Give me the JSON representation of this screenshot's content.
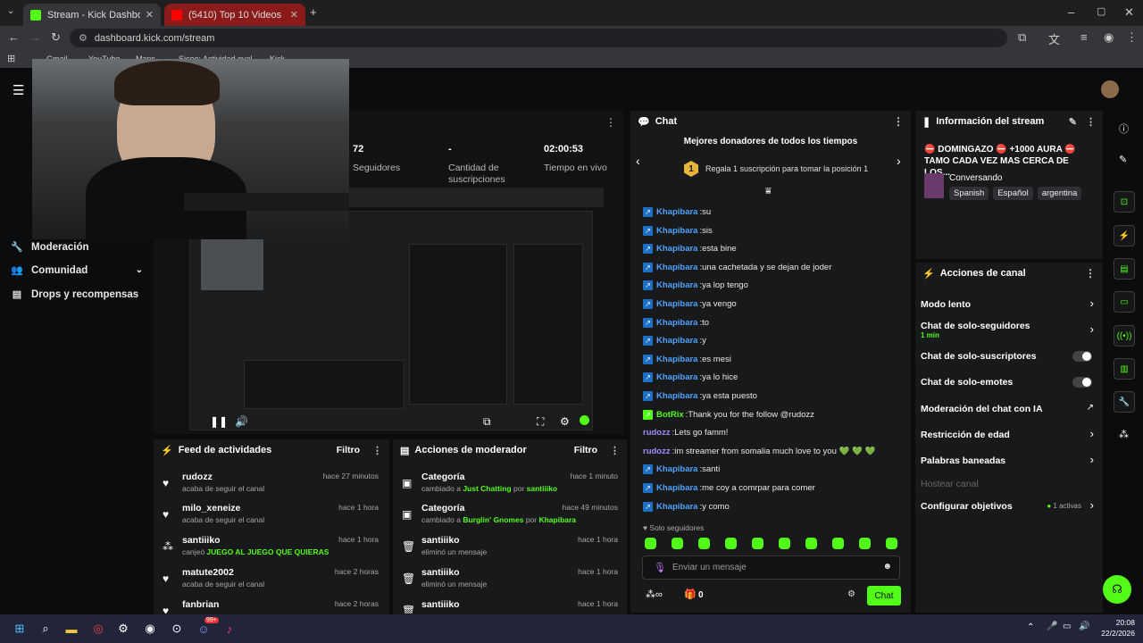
{
  "browser": {
    "tabs": [
      {
        "label": "Stream - Kick Dashboard",
        "active": true
      },
      {
        "label": "(5410) Top 10 Videos Escalofria",
        "active": false
      }
    ],
    "url": "dashboard.kick.com/stream",
    "bookmarks": [
      "Gmail",
      "YouTube",
      "Maps",
      "Sicee: Actividad eval",
      "Kick"
    ]
  },
  "sidebar": {
    "items": [
      {
        "label": "Moderación"
      },
      {
        "label": "Comunidad"
      },
      {
        "label": "Drops y recompensas"
      }
    ]
  },
  "stats": [
    {
      "value": "72",
      "label": "Seguidores"
    },
    {
      "value": "-",
      "label": "Cantidad de suscripciones"
    },
    {
      "value": "02:00:53",
      "label": "Tiempo en vivo"
    }
  ],
  "activity_feed": {
    "title": "Feed de actividades",
    "filter_label": "Filtro",
    "items": [
      {
        "name": "rudozz",
        "desc": "acaba de seguir el canal",
        "time": "hace 27 minutos",
        "icon": "heart-icon"
      },
      {
        "name": "milo_xeneize",
        "desc": "acaba de seguir el canal",
        "time": "hace 1 hora",
        "icon": "heart-icon"
      },
      {
        "name": "santiiiko",
        "desc_prefix": "canjeó ",
        "desc_highlight": "JUEGO AL JUEGO QUE QUIERAS",
        "time": "hace 1 hora",
        "icon": "reward-icon"
      },
      {
        "name": "matute2002",
        "desc": "acaba de seguir el canal",
        "time": "hace 2 horas",
        "icon": "heart-icon"
      },
      {
        "name": "fanbrian",
        "desc": "",
        "time": "hace 2 horas",
        "icon": "heart-icon"
      }
    ]
  },
  "mod_actions": {
    "title": "Acciones de moderador",
    "filter_label": "Filtro",
    "items": [
      {
        "name": "Categoría",
        "desc_prefix": "cambiado a ",
        "desc_highlight": "Just Chatting",
        "desc_mid": " por ",
        "desc_user": "santiiiko",
        "time": "hace 1 minuto"
      },
      {
        "name": "Categoría",
        "desc_prefix": "cambiado a ",
        "desc_highlight": "Burglin' Gnomes",
        "desc_mid": " por ",
        "desc_user": "Khapibara",
        "time": "hace 49 minutos"
      },
      {
        "name": "santiiiko",
        "desc_prefix": "eliminó un mensaje",
        "time": "hace 1 hora"
      },
      {
        "name": "santiiiko",
        "desc_prefix": "eliminó un mensaje",
        "time": "hace 1 hora"
      },
      {
        "name": "santiiiko",
        "desc_prefix": "",
        "time": "hace 1 hora"
      }
    ]
  },
  "chat": {
    "title": "Chat",
    "top_donors_title": "Mejores donadores de todos los tiempos",
    "donor_rank": "1",
    "donor_cta": "Regala 1 suscripción para tomar la posición 1",
    "messages": [
      {
        "user": "Khapibara",
        "text": "su",
        "type": "khapi"
      },
      {
        "user": "Khapibara",
        "text": "sis",
        "type": "khapi"
      },
      {
        "user": "Khapibara",
        "text": "esta bine",
        "type": "khapi"
      },
      {
        "user": "Khapibara",
        "text": "una cachetada y se dejan de joder",
        "type": "khapi"
      },
      {
        "user": "Khapibara",
        "text": "ya lop tengo",
        "type": "khapi"
      },
      {
        "user": "Khapibara",
        "text": "ya vengo",
        "type": "khapi"
      },
      {
        "user": "Khapibara",
        "text": "to",
        "type": "khapi"
      },
      {
        "user": "Khapibara",
        "text": "y",
        "type": "khapi"
      },
      {
        "user": "Khapibara",
        "text": "es mesi",
        "type": "khapi"
      },
      {
        "user": "Khapibara",
        "text": "ya lo hice",
        "type": "khapi"
      },
      {
        "user": "Khapibara",
        "text": "ya esta puesto",
        "type": "khapi"
      },
      {
        "user": "BotRix",
        "text": "Thank you for the follow @rudozz",
        "type": "bot"
      },
      {
        "user": "rudozz",
        "text": "Lets go famm!",
        "type": "rud"
      },
      {
        "user": "rudozz",
        "text": "im streamer from somalia much love to you 💚 💚 💚",
        "type": "rud"
      },
      {
        "user": "Khapibara",
        "text": "santi",
        "type": "khapi"
      },
      {
        "user": "Khapibara",
        "text": "me coy a comrpar para comer",
        "type": "khapi"
      },
      {
        "user": "Khapibara",
        "text": "y como",
        "type": "khapi"
      }
    ],
    "followers_only_label": "Solo seguidores",
    "input_placeholder": "Enviar un mensaje",
    "points_value": "0",
    "send_label": "Chat"
  },
  "stream_info": {
    "title": "Información del stream",
    "stream_title": "⛔ DOMINGAZO ⛔ +1000 AURA ⛔ TAMO CADA VEZ MAS CERCA DE LOS...",
    "category": "Conversando",
    "tags": [
      "Spanish",
      "Español",
      "argentina"
    ]
  },
  "channel_actions": {
    "title": "Acciones de canal",
    "items": [
      {
        "label": "Modo lento",
        "control": "chevron"
      },
      {
        "label": "Chat de solo-seguidores",
        "sub": "1 min",
        "control": "chevron"
      },
      {
        "label": "Chat de solo-suscriptores",
        "control": "toggle"
      },
      {
        "label": "Chat de solo-emotes",
        "control": "toggle"
      },
      {
        "label": "Moderación del chat con IA",
        "control": "external"
      },
      {
        "label": "Restricción de edad",
        "control": "chevron"
      },
      {
        "label": "Palabras baneadas",
        "control": "chevron"
      },
      {
        "label": "Hostear canal",
        "control": "none",
        "disabled": true
      },
      {
        "label": "Configurar objetivos",
        "badge": "1 activas",
        "control": "chevron"
      }
    ]
  },
  "taskbar": {
    "time": "20:08",
    "date": "22/2/2026",
    "badge": "99+"
  },
  "colors": {
    "accent": "#53fc18",
    "panel": "#18191b",
    "bg": "#0b0c0d"
  }
}
